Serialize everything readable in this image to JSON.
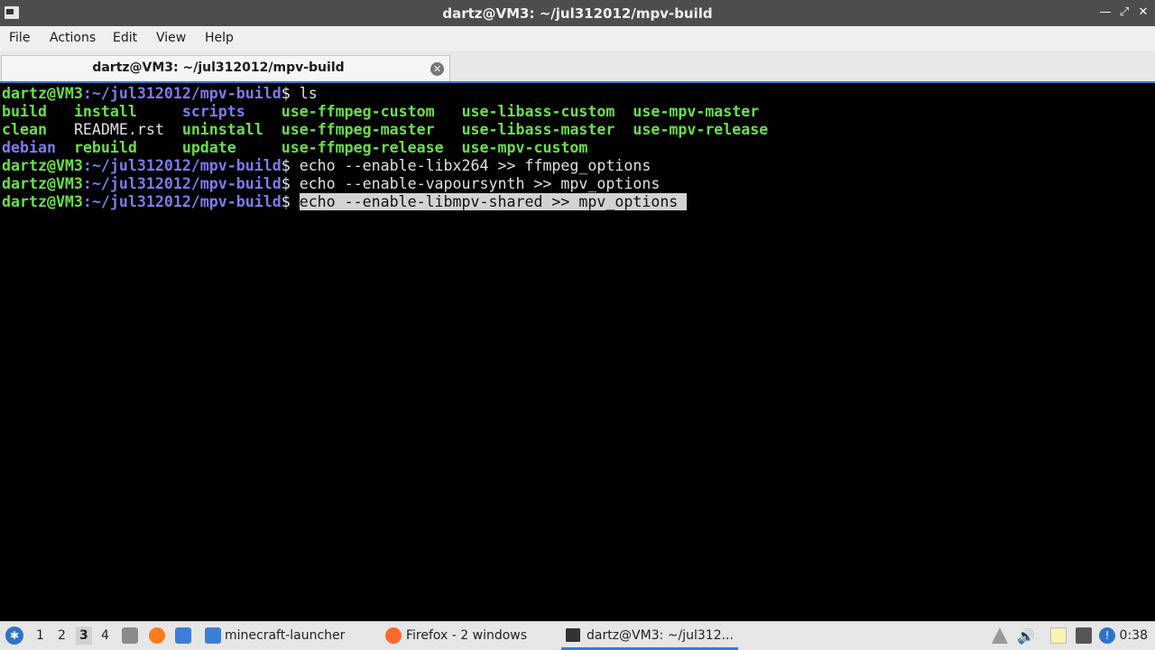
{
  "window": {
    "title": "dartz@VM3: ~/jul312012/mpv-build"
  },
  "menu": [
    "File",
    "Actions",
    "Edit",
    "View",
    "Help"
  ],
  "tab": {
    "label": "dartz@VM3: ~/jul312012/mpv-build"
  },
  "terminal": {
    "prompt_user": "dartz@VM3",
    "prompt_path": ":~/jul312012/mpv-build",
    "prompt_dollar": "$ ",
    "lines": [
      {
        "type": "cmd",
        "text": "ls"
      },
      {
        "type": "ls",
        "cols": [
          [
            {
              "t": "build",
              "c": "green"
            },
            {
              "t": "install",
              "c": "green"
            },
            {
              "t": "scripts",
              "c": "blue"
            },
            {
              "t": "use-ffmpeg-custom",
              "c": "green"
            },
            {
              "t": "use-libass-custom",
              "c": "green"
            },
            {
              "t": "use-mpv-master",
              "c": "green"
            }
          ],
          [
            {
              "t": "clean",
              "c": "green"
            },
            {
              "t": "README.rst",
              "c": "white"
            },
            {
              "t": "uninstall",
              "c": "green"
            },
            {
              "t": "use-ffmpeg-master",
              "c": "green"
            },
            {
              "t": "use-libass-master",
              "c": "green"
            },
            {
              "t": "use-mpv-release",
              "c": "green"
            }
          ],
          [
            {
              "t": "debian",
              "c": "blue"
            },
            {
              "t": "rebuild",
              "c": "green"
            },
            {
              "t": "update",
              "c": "green"
            },
            {
              "t": "use-ffmpeg-release",
              "c": "green"
            },
            {
              "t": "use-mpv-custom",
              "c": "green"
            },
            {
              "t": "",
              "c": "green"
            }
          ]
        ]
      },
      {
        "type": "cmd",
        "text": "echo --enable-libx264 >> ffmpeg_options"
      },
      {
        "type": "cmd",
        "text": "echo --enable-vapoursynth >> mpv_options"
      },
      {
        "type": "cmd",
        "text": "echo --enable-libmpv-shared >> mpv_options",
        "selected": true
      }
    ]
  },
  "taskbar": {
    "workspaces": [
      "1",
      "2",
      "3",
      "4"
    ],
    "active_workspace": "3",
    "tasks": [
      {
        "label": "minecraft-launcher",
        "icon": "folder-icon"
      },
      {
        "label": "Firefox - 2 windows",
        "icon": "firefox-icon"
      },
      {
        "label": "dartz@VM3: ~/jul312...",
        "icon": "terminal-icon",
        "active": true
      }
    ],
    "clock": "0:38"
  },
  "colors": {
    "prompt_green": "#69e04a",
    "prompt_blue": "#7c7cf0",
    "accent": "#3a7bd5"
  }
}
